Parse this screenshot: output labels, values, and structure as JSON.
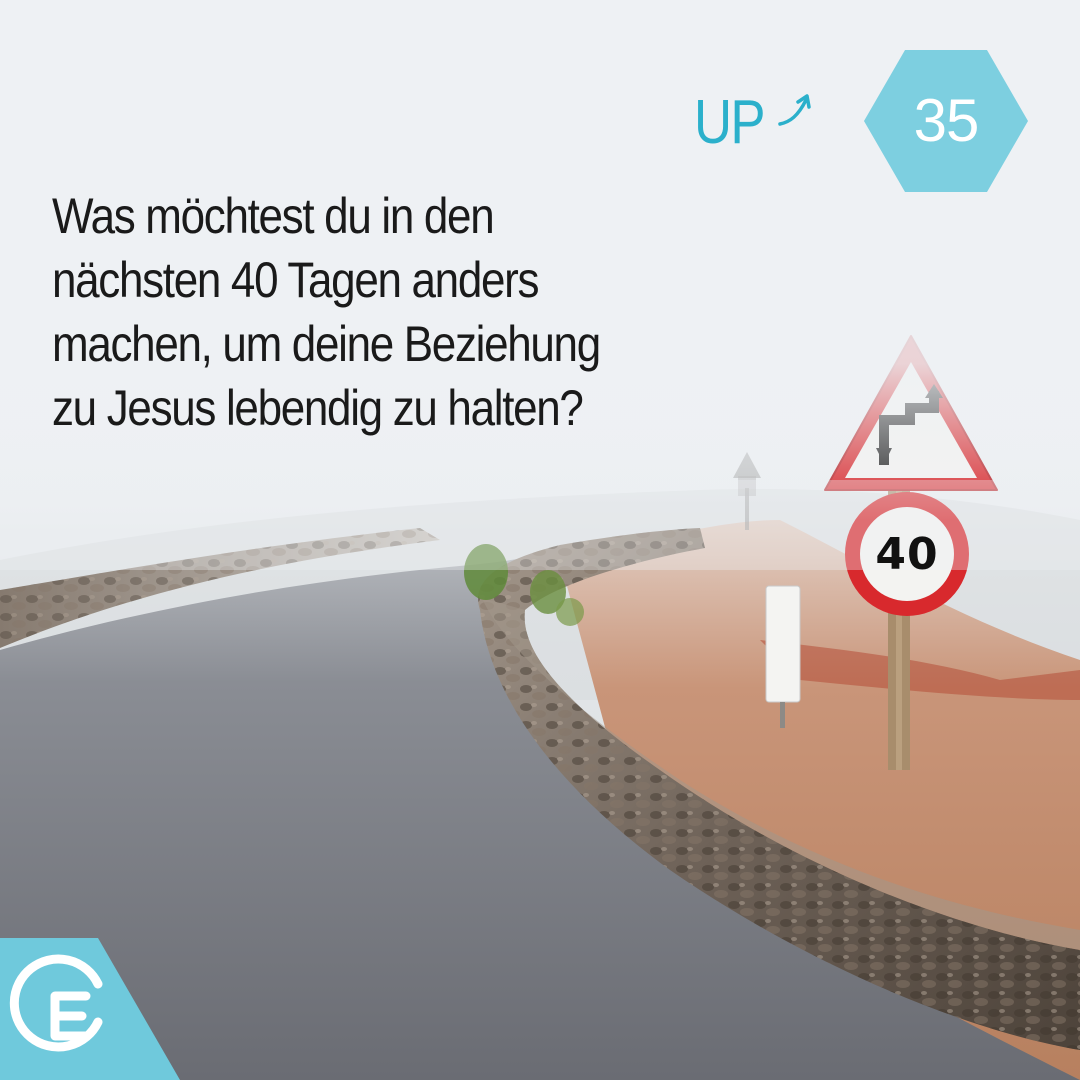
{
  "question": {
    "lines": [
      "Was möchtest du in den",
      "nächsten 40 Tagen anders",
      "machen, um deine Beziehung",
      "zu Jesus lebendig zu halten?"
    ]
  },
  "brand": {
    "up_label": "UP",
    "accent_color": "#2bb0cb",
    "badge_color": "#7dcfe0"
  },
  "badge": {
    "day_number": "35"
  },
  "road_signs": {
    "warning_sign": "double-bend-warning-sign",
    "speed_limit": "40"
  },
  "logo": {
    "icon": "ec-logo-icon"
  }
}
